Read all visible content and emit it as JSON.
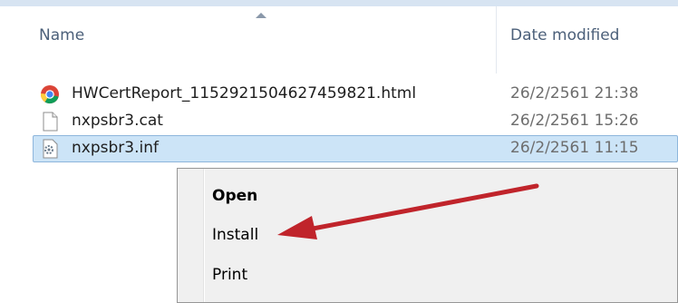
{
  "header": {
    "name_label": "Name",
    "date_label": "Date modified"
  },
  "files": [
    {
      "name": "HWCertReport_1152921504627459821.html",
      "date": "26/2/2561 21:38",
      "icon": "chrome-icon"
    },
    {
      "name": "nxpsbr3.cat",
      "date": "26/2/2561 15:26",
      "icon": "file-icon"
    },
    {
      "name": "nxpsbr3.inf",
      "date": "26/2/2561 11:15",
      "icon": "settings-file-icon",
      "selected": true
    }
  ],
  "context_menu": {
    "items": [
      "Open",
      "Install",
      "Print"
    ]
  },
  "colors": {
    "selection": "#cce4f7",
    "arrow": "#c0242b"
  }
}
